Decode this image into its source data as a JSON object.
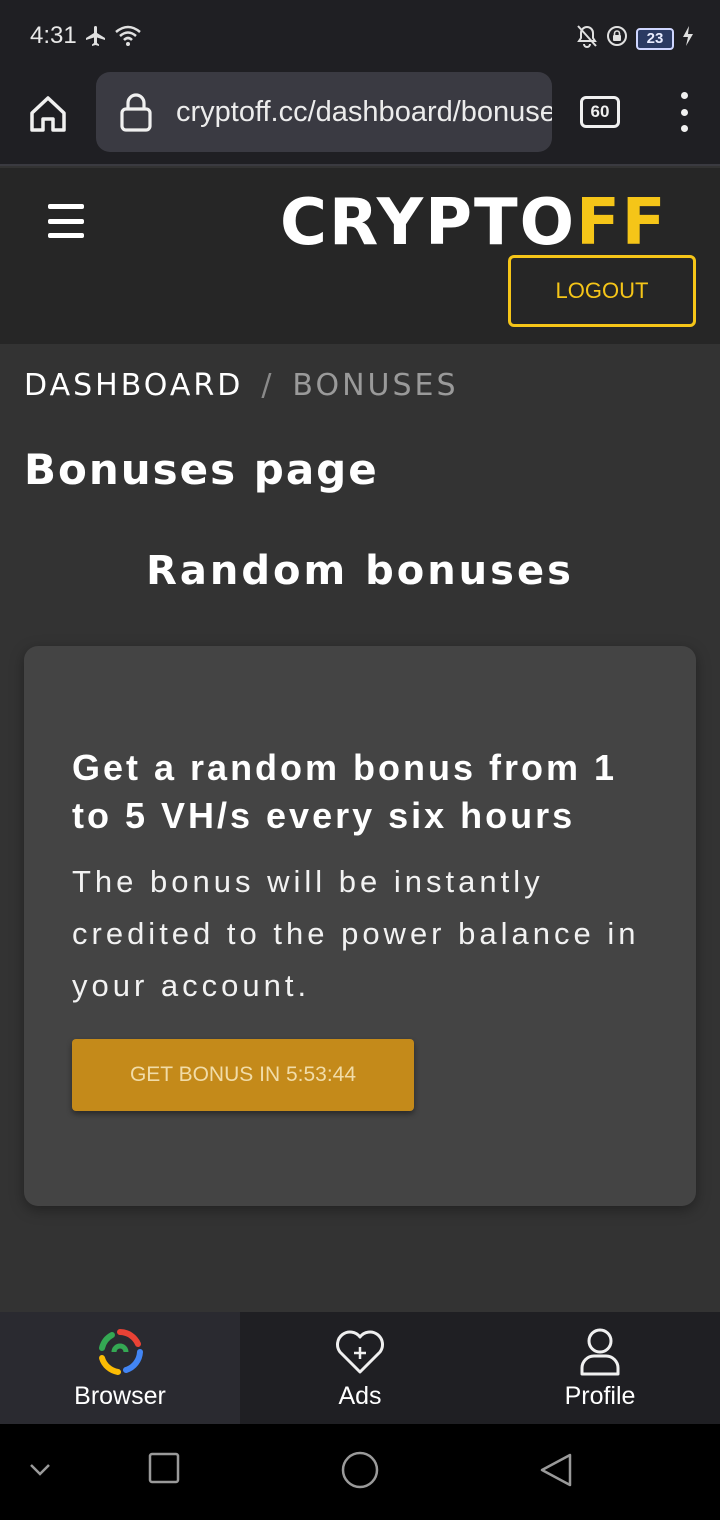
{
  "status_bar": {
    "time": "4:31",
    "battery_level": "23",
    "icons": [
      "airplane-icon",
      "wifi-icon",
      "bell-off-icon",
      "lock-rotation-icon",
      "battery-icon",
      "charging-icon"
    ]
  },
  "browser": {
    "url": "cryptoff.cc/dashboard/bonuses",
    "tab_count": "60"
  },
  "site_header": {
    "logo_main": "CRYPTO",
    "logo_accent": "FF",
    "logout_label": "LOGOUT",
    "colors": {
      "accent": "#f5c518",
      "header_bg": "#262626"
    }
  },
  "breadcrumb": {
    "root": "DASHBOARD",
    "separator": "/",
    "current": "BONUSES"
  },
  "page": {
    "title": "Bonuses page",
    "section_title": "Random bonuses"
  },
  "bonus_card": {
    "heading": "Get a random bonus from 1 to 5 VH/s every six hours",
    "description": "The bonus will be instantly credited to the power balance in your account.",
    "button_label": "GET BONUS IN 5:53:44",
    "button_color": "#c48a1a"
  },
  "bottom_nav": {
    "items": [
      {
        "label": "Browser",
        "icon": "browser-logo-icon",
        "active": true
      },
      {
        "label": "Ads",
        "icon": "heart-plus-icon",
        "active": false
      },
      {
        "label": "Profile",
        "icon": "user-icon",
        "active": false
      }
    ]
  },
  "system_nav": [
    "collapse-icon",
    "recents-icon",
    "home-icon",
    "back-icon"
  ]
}
